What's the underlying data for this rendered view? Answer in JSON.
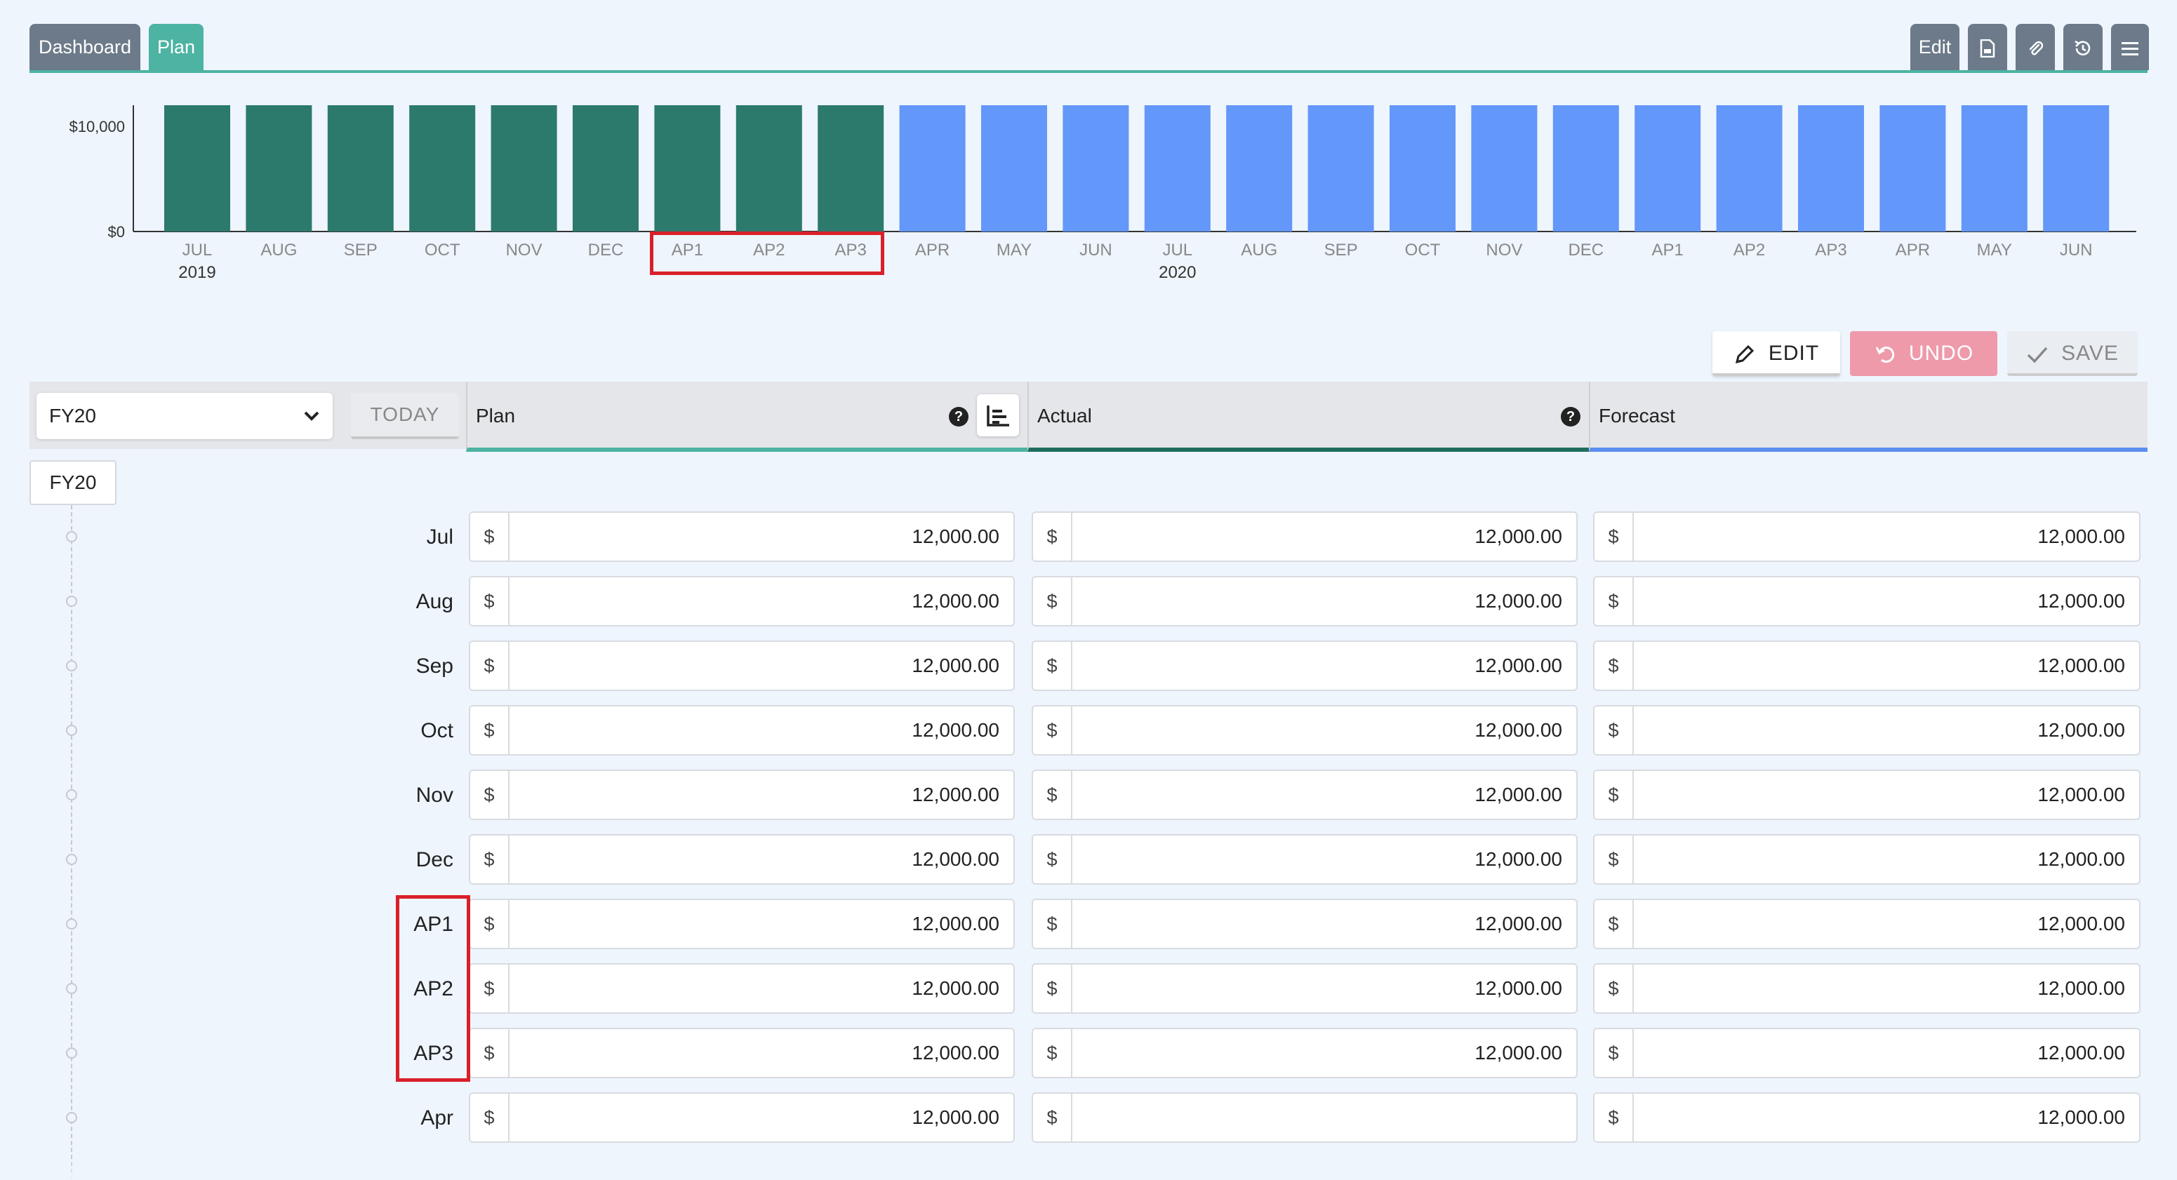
{
  "tabs": {
    "dashboard": "Dashboard",
    "plan": "Plan"
  },
  "toolbar": {
    "edit": "Edit",
    "icons": [
      "pdf-icon",
      "attachment-icon",
      "history-icon",
      "menu-icon"
    ]
  },
  "chart_data": {
    "type": "bar",
    "categories": [
      "JUL",
      "AUG",
      "SEP",
      "OCT",
      "NOV",
      "DEC",
      "AP1",
      "AP2",
      "AP3",
      "APR",
      "MAY",
      "JUN",
      "JUL",
      "AUG",
      "SEP",
      "OCT",
      "NOV",
      "DEC",
      "AP1",
      "AP2",
      "AP3",
      "APR",
      "MAY",
      "JUN"
    ],
    "year_labels": [
      {
        "index": 0,
        "label": "2019"
      },
      {
        "index": 12,
        "label": "2020"
      }
    ],
    "values": [
      12000,
      12000,
      12000,
      12000,
      12000,
      12000,
      12000,
      12000,
      12000,
      12000,
      12000,
      12000,
      12000,
      12000,
      12000,
      12000,
      12000,
      12000,
      12000,
      12000,
      12000,
      12000,
      12000,
      12000
    ],
    "bar_colors": [
      "#2c7a6c",
      "#2c7a6c",
      "#2c7a6c",
      "#2c7a6c",
      "#2c7a6c",
      "#2c7a6c",
      "#2c7a6c",
      "#2c7a6c",
      "#2c7a6c",
      "#6397f9",
      "#6397f9",
      "#6397f9",
      "#6397f9",
      "#6397f9",
      "#6397f9",
      "#6397f9",
      "#6397f9",
      "#6397f9",
      "#6397f9",
      "#6397f9",
      "#6397f9",
      "#6397f9",
      "#6397f9",
      "#6397f9"
    ],
    "ytick_labels": [
      {
        "value": 0,
        "label": "$0"
      },
      {
        "value": 10000,
        "label": "$10,000"
      }
    ],
    "ylim": [
      0,
      12000
    ],
    "highlighted_categories": [
      6,
      7,
      8
    ]
  },
  "actions": {
    "edit": "EDIT",
    "undo": "UNDO",
    "save": "SAVE"
  },
  "filter": {
    "fiscal_year": "FY20",
    "today": "TODAY"
  },
  "columns": {
    "plan": "Plan",
    "actual": "Actual",
    "forecast": "Forecast",
    "help": "?"
  },
  "group_label": "FY20",
  "currency": "$",
  "colors": {
    "plan": "#4db3a2",
    "actual": "#1e6e5e",
    "forecast": "#5b8ef0",
    "highlight": "#d9202a",
    "undo": "#ee9aab"
  },
  "rows": [
    {
      "label": "Jul",
      "plan": "12,000.00",
      "actual": "12,000.00",
      "forecast": "12,000.00"
    },
    {
      "label": "Aug",
      "plan": "12,000.00",
      "actual": "12,000.00",
      "forecast": "12,000.00"
    },
    {
      "label": "Sep",
      "plan": "12,000.00",
      "actual": "12,000.00",
      "forecast": "12,000.00"
    },
    {
      "label": "Oct",
      "plan": "12,000.00",
      "actual": "12,000.00",
      "forecast": "12,000.00"
    },
    {
      "label": "Nov",
      "plan": "12,000.00",
      "actual": "12,000.00",
      "forecast": "12,000.00"
    },
    {
      "label": "Dec",
      "plan": "12,000.00",
      "actual": "12,000.00",
      "forecast": "12,000.00"
    },
    {
      "label": "AP1",
      "plan": "12,000.00",
      "actual": "12,000.00",
      "forecast": "12,000.00"
    },
    {
      "label": "AP2",
      "plan": "12,000.00",
      "actual": "12,000.00",
      "forecast": "12,000.00"
    },
    {
      "label": "AP3",
      "plan": "12,000.00",
      "actual": "12,000.00",
      "forecast": "12,000.00"
    },
    {
      "label": "Apr",
      "plan": "12,000.00",
      "actual": "",
      "forecast": "12,000.00"
    }
  ]
}
